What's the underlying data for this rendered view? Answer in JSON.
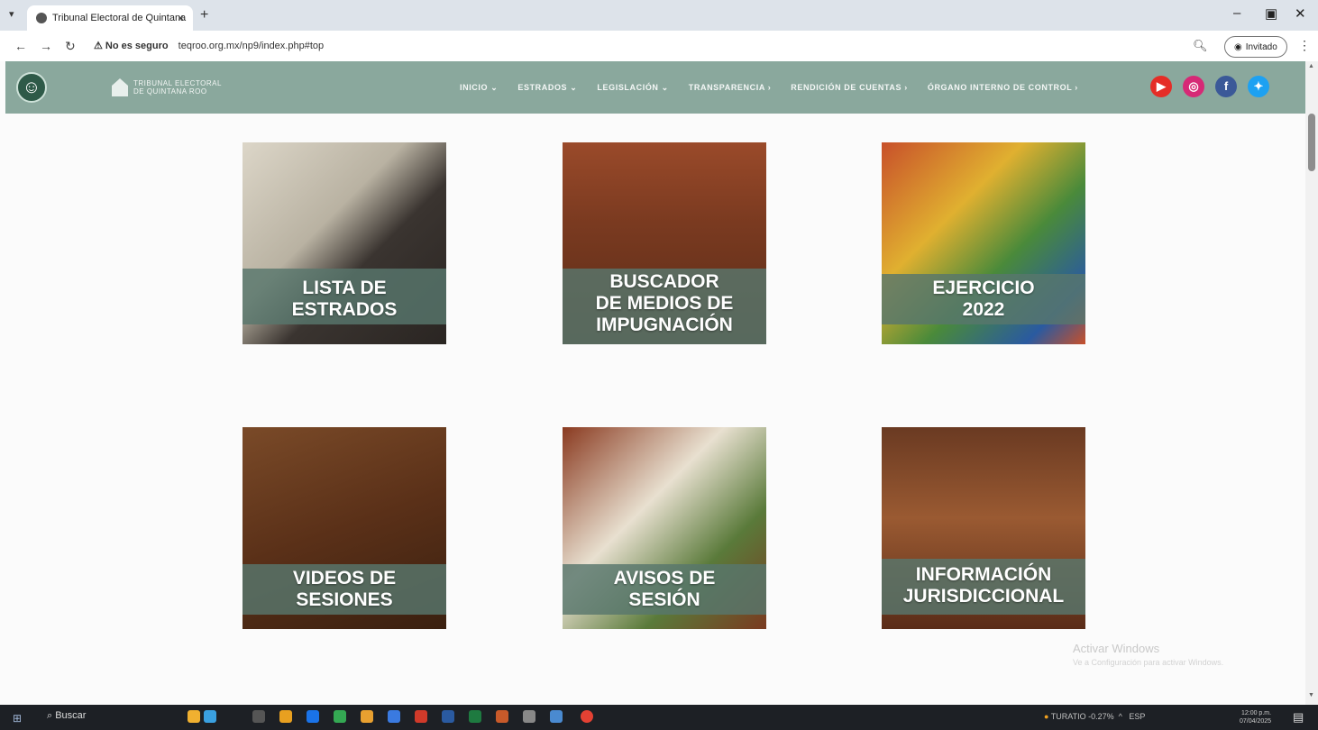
{
  "browser": {
    "tab_title": "Tribunal Electoral de Quintana",
    "tab_close": "×",
    "new_tab": "+",
    "security_label": "No es seguro",
    "url": "teqroo.org.mx/np9/index.php#top",
    "profile_label": "Invitado"
  },
  "site": {
    "logo_line1": "TRIBUNAL ELECTORAL",
    "logo_line2": "DE QUINTANA ROO",
    "nav": [
      "INICIO",
      "ESTRADOS",
      "LEGISLACIÓN",
      "TRANSPARENCIA",
      "RENDICIÓN DE CUENTAS",
      "ÓRGANO INTERNO DE CONTROL"
    ],
    "social_icons": [
      "youtube-icon",
      "instagram-icon",
      "facebook-icon",
      "twitter-icon"
    ]
  },
  "tiles": [
    {
      "line1": "LISTA DE",
      "line2": "ESTRADOS",
      "line3": ""
    },
    {
      "line1": "BUSCADOR",
      "line2": "DE MEDIOS DE",
      "line3": "IMPUGNACIÓN"
    },
    {
      "line1": "EJERCICIO",
      "line2": "2022",
      "line3": ""
    },
    {
      "line1": "VIDEOS DE",
      "line2": "SESIONES",
      "line3": ""
    },
    {
      "line1": "AVISOS DE",
      "line2": "SESIÓN",
      "line3": ""
    },
    {
      "line1": "INFORMACIÓN",
      "line2": "JURISDICCIONAL",
      "line3": ""
    }
  ],
  "watermark": {
    "title": "Activar Windows",
    "subtitle": "Ve a Configuración para activar Windows."
  },
  "taskbar": {
    "search": "Buscar",
    "weather": "TURATIO -0.27%",
    "time": "12:00 p.m.",
    "date": "07/04/2025",
    "lang": "ESP"
  },
  "colors": {
    "header_bg": "#8aa89d",
    "tile_bar": "#58766c",
    "accessibility_bg": "#2e5a48"
  }
}
